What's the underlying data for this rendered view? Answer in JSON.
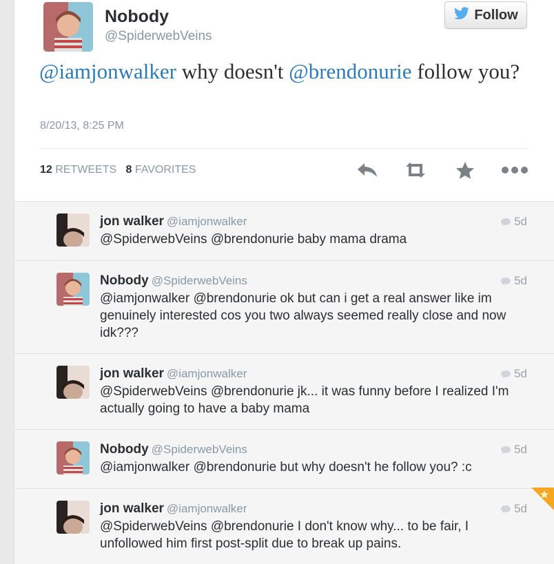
{
  "tweet": {
    "author_name": "Nobody",
    "author_handle": "@SpiderwebVeins",
    "follow_label": "Follow",
    "text_parts": {
      "mention1": "@iamjonwalker",
      "mid": " why doesn't ",
      "mention2": "@brendonurie",
      "end": " follow you?"
    },
    "date": "8/20/13, 8:25 PM",
    "retweets_count": "12",
    "retweets_label": "RETWEETS",
    "favorites_count": "8",
    "favorites_label": "FAVORITES"
  },
  "icons": {
    "follow": "twitter-bird-icon",
    "reply": "reply-icon",
    "retweet": "retweet-icon",
    "favorite": "star-icon",
    "more": "more-icon",
    "time": "speech-bubble-icon"
  },
  "colors": {
    "link": "#2b7bb9",
    "twitter_blue": "#55acee",
    "muted": "#8899a6",
    "replies_bg": "#f5f5f5",
    "ribbon": "#f5a623"
  },
  "replies": [
    {
      "name": "jon walker",
      "handle": "@iamjonwalker",
      "time": "5d",
      "text": "@SpiderwebVeins @brendonurie baby mama drama"
    },
    {
      "name": "Nobody",
      "handle": "@SpiderwebVeins",
      "time": "5d",
      "text": "@iamjonwalker @brendonurie ok but can i get a real answer like im genuinely interested cos you two always seemed really close and now idk???"
    },
    {
      "name": "jon walker",
      "handle": "@iamjonwalker",
      "time": "5d",
      "text": "@SpiderwebVeins @brendonurie jk... it was funny before I realized I'm actually going to have a baby mama"
    },
    {
      "name": "Nobody",
      "handle": "@SpiderwebVeins",
      "time": "5d",
      "text": "@iamjonwalker @brendonurie but why doesn't he follow you? :c"
    },
    {
      "name": "jon walker",
      "handle": "@iamjonwalker",
      "time": "5d",
      "text": "@SpiderwebVeins @brendonurie I don't know why... to be fair, I unfollowed him first post-split due to break up pains."
    }
  ]
}
